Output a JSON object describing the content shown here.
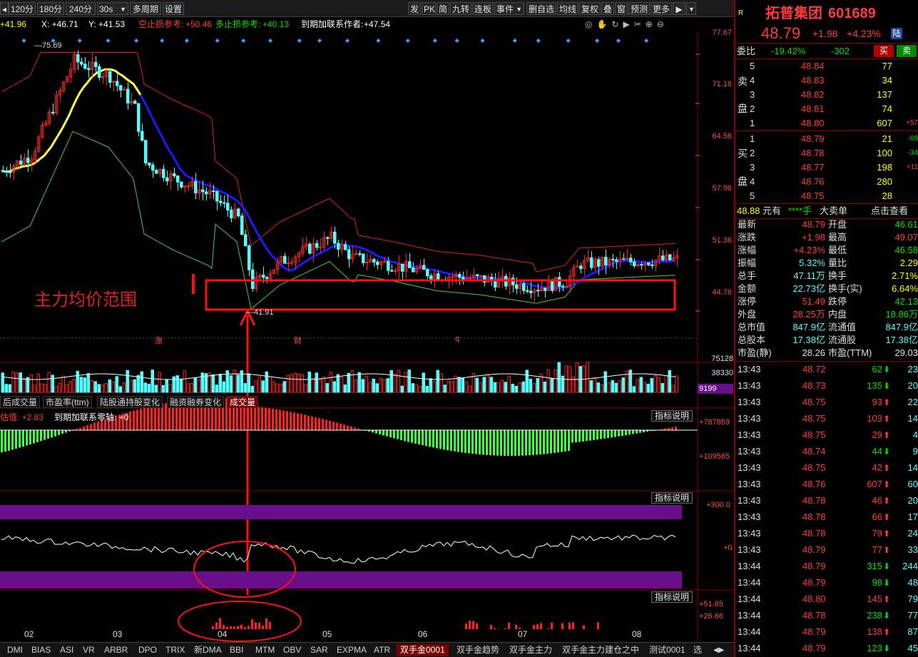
{
  "toolbar": {
    "items": [
      "120分",
      "180分",
      "240分",
      "30s",
      "多周期",
      "设置"
    ],
    "right_items": [
      "发",
      "PK",
      "简",
      "九转",
      "连板",
      "事件",
      "删自选",
      "均线",
      "复权",
      "叠",
      "窗",
      "预测",
      "更多"
    ]
  },
  "info": {
    "v1": "+41.96",
    "x": "X: +46.71",
    "y": "Y: +41.53",
    "kong_label": "空止损参考:",
    "kong_val": "+50.46",
    "duo_label": "多止损参考:",
    "duo_val": "+40.13",
    "author_label": "到期加联系作者:",
    "author_val": "+47.54"
  },
  "price_axis": [
    "77.67",
    "71.16",
    "64.56",
    "57.96",
    "51.36",
    "44.76"
  ],
  "chart_labels": {
    "high": "75.69",
    "low": "41.91",
    "annotation": "主力均价范围",
    "event_marks": [
      "涨",
      "财",
      "q"
    ]
  },
  "volume_axis": [
    "75128",
    "38330",
    "9199"
  ],
  "sub_tabs": [
    "后成交量",
    "市盈率(ttm)",
    "陆股通持股变化",
    "融资融券变化",
    "成交量"
  ],
  "macd": {
    "label1": "估值: +2.83",
    "label2": "到期加联系零轴: +0",
    "axis": [
      "+787859",
      "+109565"
    ],
    "explain": "指标说明"
  },
  "osc": {
    "axis": [
      "+300.0",
      "+0"
    ],
    "explain": "指标说明"
  },
  "bars3": {
    "axis": [
      "+51.85",
      "+26.66"
    ],
    "explain": "指标说明"
  },
  "months": [
    "02",
    "03",
    "04",
    "05",
    "06",
    "07",
    "08"
  ],
  "tabs": [
    "DMI",
    "BIAS",
    "ASI",
    "VR",
    "ARBR",
    "DPO",
    "TRIX",
    "新DMA",
    "BBI",
    "MTM",
    "OBV",
    "SAR",
    "EXPMA",
    "ATR",
    "双手金0001",
    "双手金趋势",
    "双手金主力",
    "双手金主力建仓之中",
    "测试0001",
    "选"
  ],
  "stock": {
    "badge": "R",
    "name": "拓普集团",
    "code": "601689",
    "price": "48.79",
    "change": "+1.98",
    "pct": "+4.23%",
    "tag": "陆"
  },
  "weibi": {
    "label": "委比",
    "ratio": "-19.42%",
    "diff": "-302",
    "buy": "买",
    "sell": "卖"
  },
  "sell_orders": [
    {
      "n": "5",
      "price": "48.84",
      "vol": "77",
      "chg": ""
    },
    {
      "n": "4",
      "price": "48.83",
      "vol": "34",
      "chg": ""
    },
    {
      "n": "3",
      "price": "48.82",
      "vol": "137",
      "chg": ""
    },
    {
      "n": "2",
      "price": "48.81",
      "vol": "74",
      "chg": ""
    },
    {
      "n": "1",
      "price": "48.80",
      "vol": "607",
      "chg": "+57"
    }
  ],
  "buy_orders": [
    {
      "n": "1",
      "price": "48.79",
      "vol": "21",
      "chg": "-69"
    },
    {
      "n": "2",
      "price": "48.78",
      "vol": "100",
      "chg": "-34"
    },
    {
      "n": "3",
      "price": "48.77",
      "vol": "198",
      "chg": "+11"
    },
    {
      "n": "4",
      "price": "48.76",
      "vol": "280",
      "chg": ""
    },
    {
      "n": "5",
      "price": "48.75",
      "vol": "28",
      "chg": ""
    }
  ],
  "side_labels": {
    "sell_a": "卖",
    "sell_b": "盘",
    "buy_a": "买",
    "buy_b": "盘"
  },
  "bigorder": {
    "price": "48.88",
    "unit": "元有",
    "stars": "****手",
    "big": "大卖单",
    "click": "点击查看"
  },
  "quote": [
    {
      "l": "最新",
      "lv": "48.79",
      "r": "开盘",
      "rv": "46.61"
    },
    {
      "l": "涨跌",
      "lv": "+1.98",
      "r": "最高",
      "rv": "49.07"
    },
    {
      "l": "涨幅",
      "lv": "+4.23%",
      "r": "最低",
      "rv": "46.58"
    },
    {
      "l": "振幅",
      "lv": "5.32%",
      "r": "量比",
      "rv": "2.29"
    },
    {
      "l": "总手",
      "lv": "47.11万",
      "r": "换手",
      "rv": "2.71%"
    },
    {
      "l": "金额",
      "lv": "22.73亿",
      "r": "换手(实)",
      "rv": "6.64%"
    },
    {
      "l": "涨停",
      "lv": "51.49",
      "r": "跌停",
      "rv": "42.13"
    },
    {
      "l": "外盘",
      "lv": "28.25万",
      "r": "内盘",
      "rv": "18.86万"
    },
    {
      "l": "总市值",
      "lv": "847.9亿",
      "r": "流通值",
      "rv": "847.9亿"
    },
    {
      "l": "总股本",
      "lv": "17.38亿",
      "r": "流通股",
      "rv": "17.38亿"
    },
    {
      "l": "市盈(静)",
      "lv": "28.26",
      "r": "市盈(TTM)",
      "rv": "29.03"
    }
  ],
  "ticks": [
    {
      "t": "13:43",
      "p": "48.72",
      "v": "62",
      "d": "down",
      "n": "23"
    },
    {
      "t": "13:43",
      "p": "48.73",
      "v": "135",
      "d": "down",
      "n": "20"
    },
    {
      "t": "13:43",
      "p": "48.75",
      "v": "93",
      "d": "up",
      "n": "22"
    },
    {
      "t": "13:43",
      "p": "48.75",
      "v": "103",
      "d": "up",
      "n": "14"
    },
    {
      "t": "13:43",
      "p": "48.75",
      "v": "29",
      "d": "up",
      "n": "4"
    },
    {
      "t": "13:43",
      "p": "48.74",
      "v": "44",
      "d": "down",
      "n": "9"
    },
    {
      "t": "13:43",
      "p": "48.75",
      "v": "42",
      "d": "up",
      "n": "14"
    },
    {
      "t": "13:43",
      "p": "48.76",
      "v": "607",
      "d": "up",
      "n": "60"
    },
    {
      "t": "13:43",
      "p": "48.78",
      "v": "46",
      "d": "up",
      "n": "20"
    },
    {
      "t": "13:43",
      "p": "48.78",
      "v": "66",
      "d": "up",
      "n": "17"
    },
    {
      "t": "13:43",
      "p": "48.78",
      "v": "79",
      "d": "up",
      "n": "24"
    },
    {
      "t": "13:43",
      "p": "48.79",
      "v": "77",
      "d": "up",
      "n": "33"
    },
    {
      "t": "13:44",
      "p": "48.79",
      "v": "315",
      "d": "down",
      "n": "244"
    },
    {
      "t": "13:44",
      "p": "48.79",
      "v": "98",
      "d": "down",
      "n": "48"
    },
    {
      "t": "13:44",
      "p": "48.80",
      "v": "145",
      "d": "up",
      "n": "79"
    },
    {
      "t": "13:44",
      "p": "48.78",
      "v": "238",
      "d": "down",
      "n": "77"
    },
    {
      "t": "13:44",
      "p": "48.79",
      "v": "138",
      "d": "up",
      "n": "87"
    },
    {
      "t": "13:44",
      "p": "48.79",
      "v": "123",
      "d": "down",
      "n": "45"
    }
  ],
  "colors": {
    "up": "#ff3b3b",
    "down": "#00e000",
    "cyan": "#54ffff",
    "ma_blue": "#1a1aff",
    "ma_yellow": "#ffff40",
    "purple": "#6a0f8c",
    "frame": "#8a0000"
  }
}
